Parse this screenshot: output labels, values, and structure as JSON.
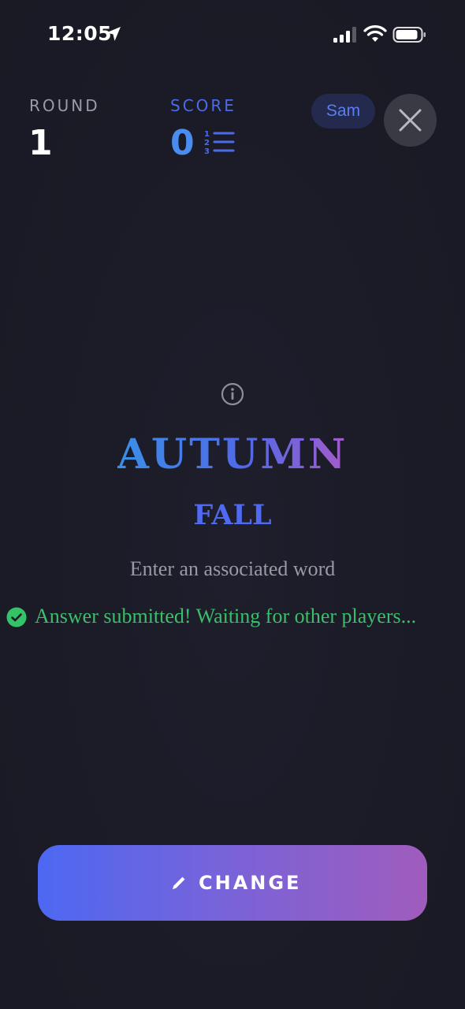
{
  "status_bar": {
    "time": "12:05",
    "icons": [
      "location-arrow-icon",
      "cellular-signal-icon",
      "wifi-icon",
      "battery-icon"
    ]
  },
  "header": {
    "round_label": "ROUND",
    "round_value": "1",
    "score_label": "SCORE",
    "score_value": "0",
    "player_name": "Sam",
    "icons": [
      "ranking-list-icon",
      "close-icon"
    ]
  },
  "game": {
    "prompt_word": "AUTUMN",
    "answer_word": "FALL",
    "hint": "Enter an associated word",
    "status_message": "Answer submitted! Waiting for other players...",
    "icons": [
      "info-icon",
      "check-circle-icon"
    ]
  },
  "action": {
    "change_label": "CHANGE",
    "icon": "pencil-icon"
  },
  "colors": {
    "background": "#1b1b27",
    "accent_blue": "#4f6af0",
    "success_green": "#3cbe6a",
    "button_gradient_start": "#4d68f2",
    "button_gradient_end": "#a05cbd"
  }
}
